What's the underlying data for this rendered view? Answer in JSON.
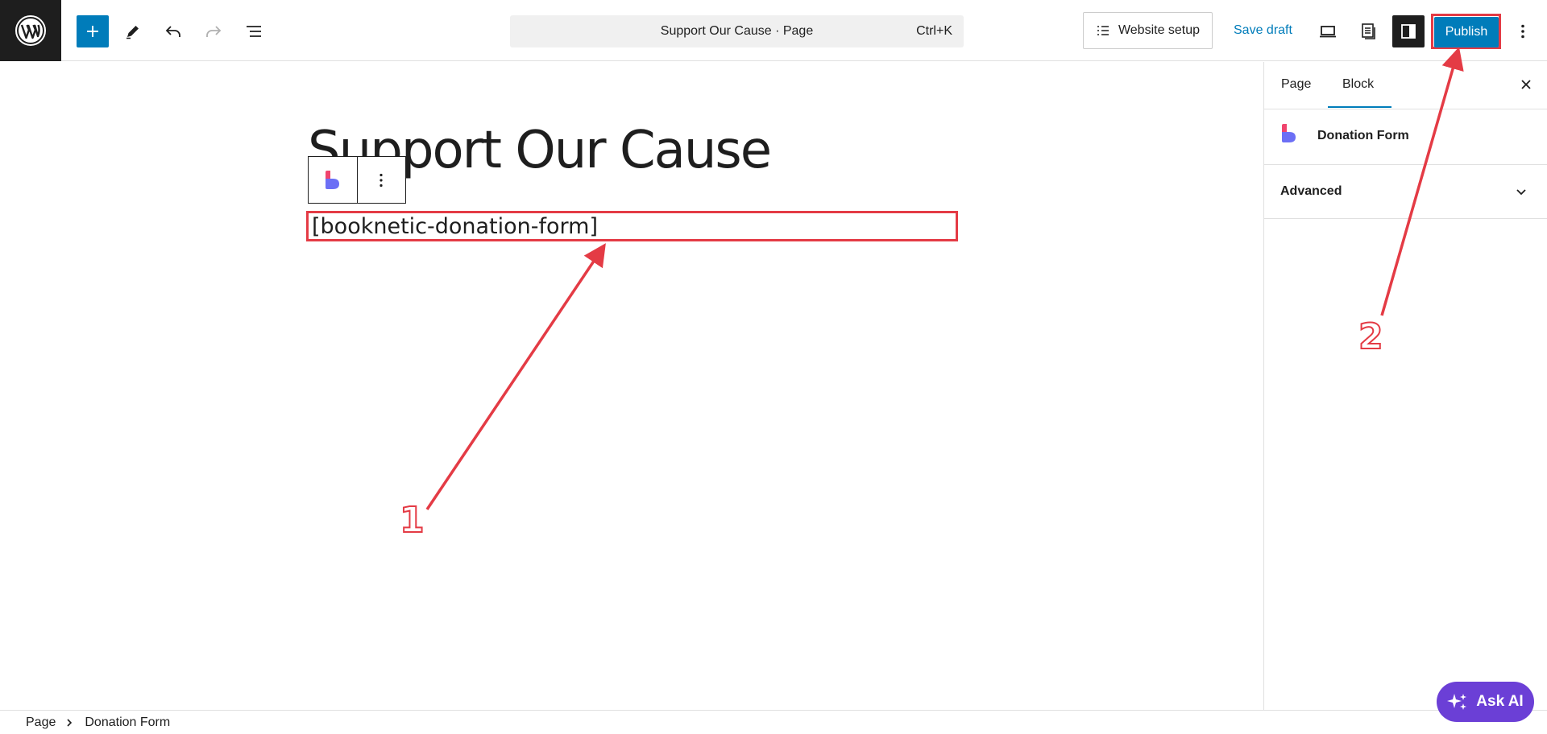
{
  "toolbar": {
    "command_bar_title": "Support Our Cause · Page",
    "command_bar_shortcut": "Ctrl+K",
    "website_setup_label": "Website setup",
    "save_draft_label": "Save draft",
    "publish_label": "Publish"
  },
  "canvas": {
    "page_title": "Support Our Cause",
    "shortcode": "[booknetic-donation-form]"
  },
  "annotations": {
    "step1": "1",
    "step2": "2",
    "color": "#e43b45"
  },
  "sidebar": {
    "tabs": [
      {
        "label": "Page",
        "active": false
      },
      {
        "label": "Block",
        "active": true
      }
    ],
    "block_name": "Donation Form",
    "advanced_label": "Advanced"
  },
  "footer": {
    "breadcrumbs": [
      "Page",
      "Donation Form"
    ]
  },
  "ask_ai": {
    "label": "Ask AI"
  },
  "colors": {
    "accent": "#007cba",
    "dark": "#1e1e1e",
    "annotation_red": "#e43b45",
    "ask_ai_purple": "#6b3fd6"
  }
}
